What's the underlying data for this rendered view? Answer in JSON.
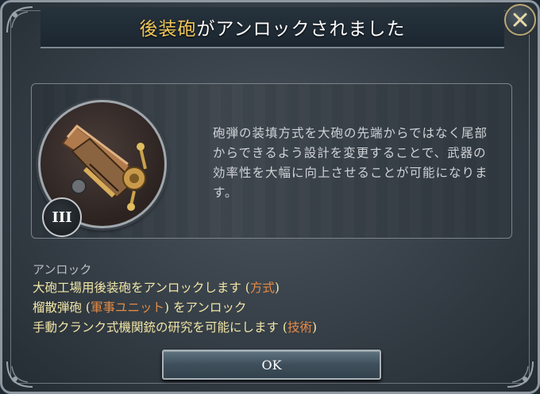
{
  "dialog": {
    "title_highlight": "後装砲",
    "title_rest": "がアンロックされました",
    "tier": "III",
    "description": "砲弾の装填方式を大砲の先端からではなく尾部からできるよう設計を変更することで、武器の効率性を大幅に向上させることが可能になります。",
    "unlock_heading": "アンロック",
    "unlocks": [
      {
        "prefix": "大砲工場用後装砲をアンロックします (",
        "link": "方式",
        "suffix": ")"
      },
      {
        "prefix": "榴散弾砲 (",
        "link": "軍事ユニット",
        "suffix": ") をアンロック"
      },
      {
        "prefix": "手動クランク式機関銃の研究を可能にします (",
        "link": "技術",
        "suffix": ")"
      }
    ],
    "ok_label": "OK"
  },
  "colors": {
    "title_highlight": "#f0c75a",
    "unlock_text": "#f2e6a6",
    "link_text": "#e58a45",
    "description_text": "#cfd3d6"
  },
  "icons": {
    "close": "close-x-icon",
    "unlock_item": "breech-loading-cannon-icon"
  }
}
